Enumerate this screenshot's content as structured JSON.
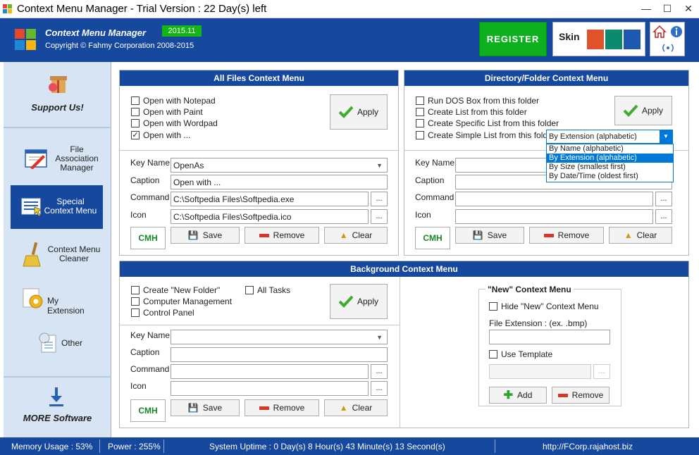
{
  "window": {
    "title": "Context Menu Manager - Trial Version : 22 Day(s) left",
    "min": "—",
    "max": "☐",
    "close": "✕"
  },
  "header": {
    "app_name": "Context Menu Manager",
    "version": "2015.11",
    "copyright": "Copyright © Fahmy Corporation 2008-2015",
    "register": "REGISTER",
    "skin_label": "Skin",
    "skin_colors": [
      "#e0532a",
      "#0c8a6e",
      "#1e58b0"
    ]
  },
  "sidebar": {
    "support": "Support Us!",
    "items": [
      {
        "label": "File Association Manager"
      },
      {
        "label": "Special Context Menu"
      },
      {
        "label": "Context Menu Cleaner"
      },
      {
        "label": "My Extension"
      },
      {
        "label": "Other"
      }
    ],
    "more": "MORE Software"
  },
  "all_files": {
    "title": "All Files Context Menu",
    "options": [
      {
        "label": "Open with Notepad",
        "checked": false
      },
      {
        "label": "Open with Paint",
        "checked": false
      },
      {
        "label": "Open with Wordpad",
        "checked": false
      },
      {
        "label": "Open with ...",
        "checked": true
      }
    ],
    "apply": "Apply",
    "key_name_label": "Key Name",
    "key_name": "OpenAs",
    "caption_label": "Caption",
    "caption": "Open with ...",
    "command_label": "Command",
    "command": "C:\\Softpedia Files\\Softpedia.exe",
    "icon_label": "Icon",
    "icon": "C:\\Softpedia Files\\Softpedia.ico",
    "browse": "...",
    "cmh": "CMH",
    "save": "Save",
    "remove": "Remove",
    "clear": "Clear"
  },
  "directory": {
    "title": "Directory/Folder Context Menu",
    "options": [
      {
        "label": "Run DOS Box from this folder",
        "checked": false
      },
      {
        "label": "Create List from this folder",
        "checked": false
      },
      {
        "label": "Create Specific List from this folder",
        "checked": false
      },
      {
        "label": "Create Simple List from this folder",
        "checked": false
      }
    ],
    "apply": "Apply",
    "sort_selected": "By Extension (alphabetic)",
    "sort_options": [
      "By Name (alphabetic)",
      "By Extension (alphabetic)",
      "By Size (smallest first)",
      "By Date/Time (oldest first)"
    ],
    "key_name_label": "Key Name",
    "caption_label": "Caption",
    "command_label": "Command",
    "icon_label": "Icon",
    "browse": "...",
    "cmh": "CMH",
    "save": "Save",
    "remove": "Remove",
    "clear": "Clear"
  },
  "background": {
    "title": "Background Context Menu",
    "options": [
      {
        "label": "Create \"New Folder\"",
        "checked": false
      },
      {
        "label": "Computer Management",
        "checked": false
      },
      {
        "label": "Control Panel",
        "checked": false
      },
      {
        "label": "All Tasks",
        "checked": false
      }
    ],
    "apply": "Apply",
    "key_name_label": "Key Name",
    "caption_label": "Caption",
    "command_label": "Command",
    "icon_label": "Icon",
    "browse": "...",
    "cmh": "CMH",
    "save": "Save",
    "remove": "Remove",
    "clear": "Clear"
  },
  "new_menu": {
    "title": "\"New\" Context Menu",
    "hide_label": "Hide \"New\" Context Menu",
    "ext_label": "File Extension : (ex. .bmp)",
    "template_label": "Use Template",
    "browse": "...",
    "add": "Add",
    "remove": "Remove"
  },
  "status": {
    "memory": "Memory Usage : 53%",
    "power": "Power : 255%",
    "uptime": "System Uptime : 0 Day(s) 8 Hour(s) 43 Minute(s) 13 Second(s)",
    "url": "http://FCorp.rajahost.biz"
  }
}
